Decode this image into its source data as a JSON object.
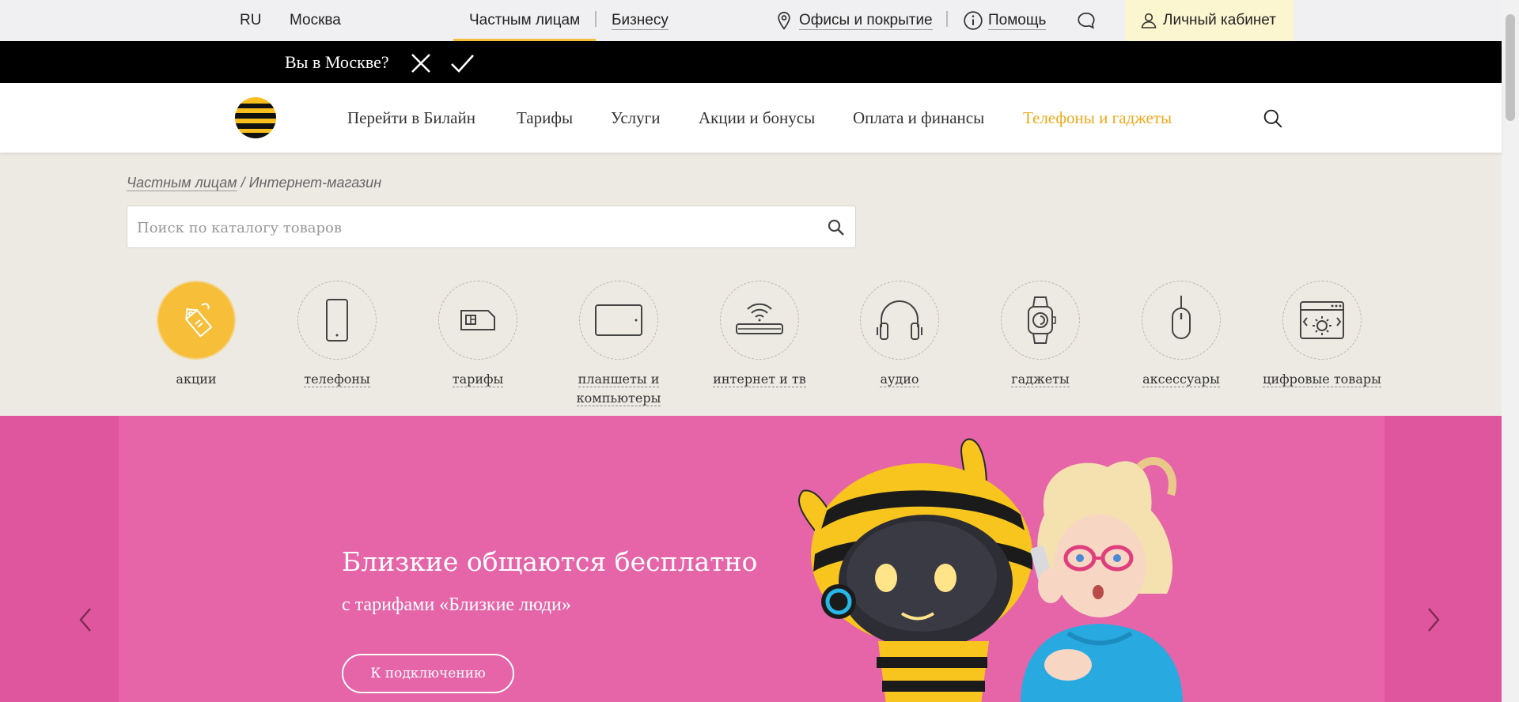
{
  "topbar": {
    "lang": "RU",
    "city": "Москва",
    "segment_private": "Частным лицам",
    "segment_business": "Бизнесу",
    "offices": "Офисы и покрытие",
    "help": "Помощь",
    "cabinet": "Личный кабинет",
    "icons": [
      "pin-icon",
      "info-icon",
      "chat-icon",
      "user-icon"
    ]
  },
  "city_prompt": {
    "question": "Вы в Москве?",
    "icons": [
      "close-icon",
      "check-icon"
    ]
  },
  "mainnav": {
    "items": [
      "Перейти в Билайн",
      "Тарифы",
      "Услуги",
      "Акции и бонусы",
      "Оплата и финансы",
      "Телефоны и гаджеты"
    ],
    "active_index": 5,
    "icons": [
      "beeline-logo",
      "search-icon"
    ]
  },
  "breadcrumb": {
    "first": "Частным лицам",
    "separator": "/",
    "current": "Интернет-магазин"
  },
  "search": {
    "placeholder": "Поиск по каталогу товаров",
    "value": ""
  },
  "categories": [
    {
      "label": "акции",
      "icon": "tag-icon",
      "active": true
    },
    {
      "label": "телефоны",
      "icon": "phone-icon",
      "active": false
    },
    {
      "label": "тарифы",
      "icon": "sim-card-icon",
      "active": false
    },
    {
      "label": "планшеты и компьютеры",
      "icon": "tablet-icon",
      "active": false
    },
    {
      "label": "интернет и тв",
      "icon": "router-icon",
      "active": false
    },
    {
      "label": "аудио",
      "icon": "headphones-icon",
      "active": false
    },
    {
      "label": "гаджеты",
      "icon": "smartwatch-icon",
      "active": false
    },
    {
      "label": "аксессуары",
      "icon": "mouse-icon",
      "active": false
    },
    {
      "label": "цифровые товары",
      "icon": "digital-goods-icon",
      "active": false
    }
  ],
  "banner": {
    "title": "Близкие общаются бесплатно",
    "subtitle": "с тарифами «Близкие люди»",
    "cta": "К подключению",
    "icons": [
      "chevron-left-icon",
      "chevron-right-icon"
    ]
  },
  "colors": {
    "accent": "#f7be3a",
    "active_link": "#f0a81a",
    "banner_bg": "#e0569e",
    "catalog_bg": "#edeae4",
    "topbar_bg": "#f0f0f2",
    "cabinet_bg": "#fbf6cf"
  }
}
